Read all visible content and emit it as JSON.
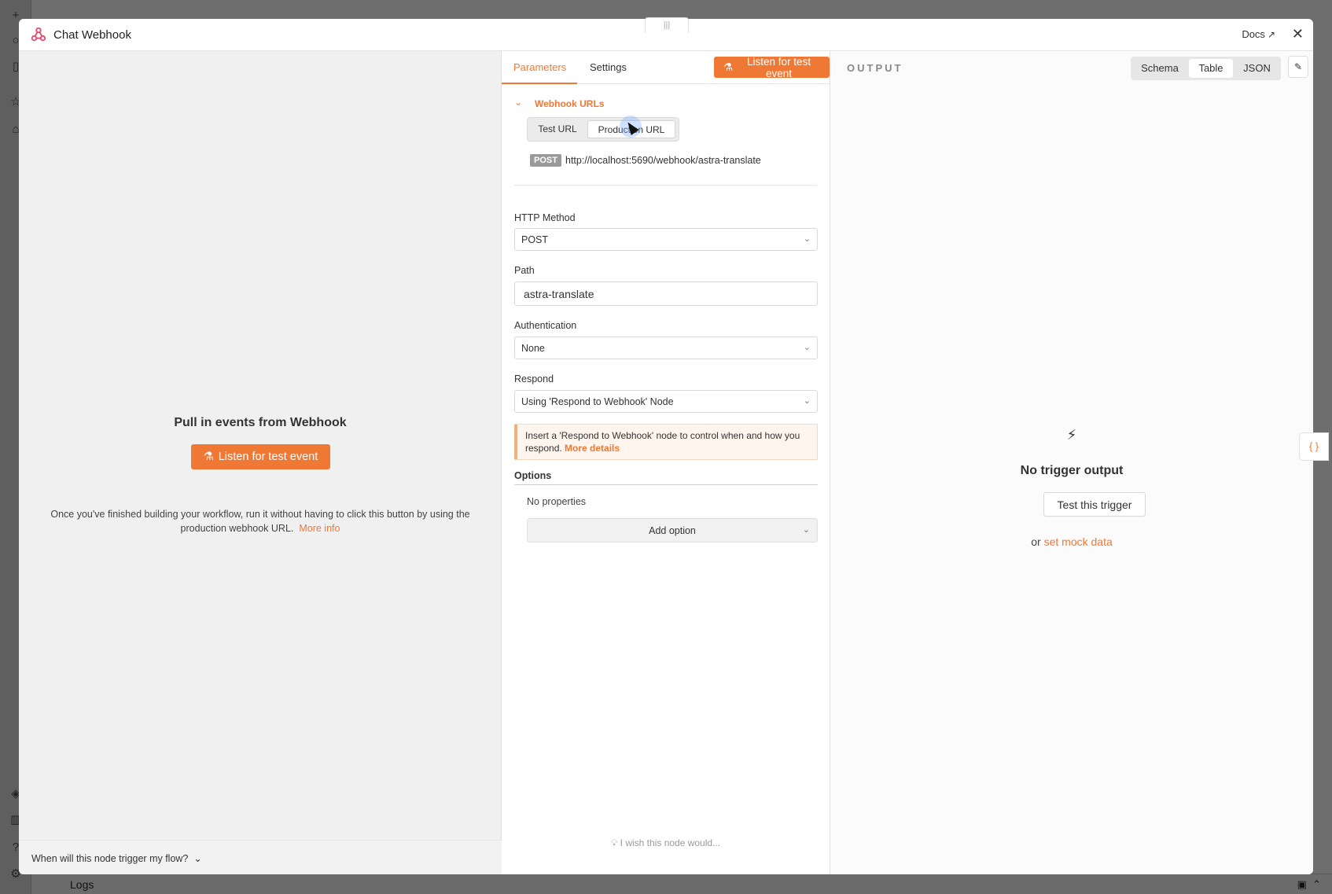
{
  "modal": {
    "title": "Chat Webhook",
    "docs_label": "Docs",
    "close_glyph": "✕"
  },
  "left": {
    "heading": "Pull in events from Webhook",
    "listen_label": "Listen for test event",
    "description": "Once you've finished building your workflow, run it without having to click this button by using the production webhook URL.",
    "more_info": "More info",
    "trigger_question": "When will this node trigger my flow?"
  },
  "tabs": {
    "parameters": "Parameters",
    "settings": "Settings",
    "listen_label": "Listen for test event"
  },
  "webhook_urls": {
    "title": "Webhook URLs",
    "options": [
      "Test URL",
      "Production URL"
    ],
    "selected": "Production URL",
    "method_badge": "POST",
    "url": "http://localhost:5690/webhook/astra-translate"
  },
  "fields": {
    "http_method_label": "HTTP Method",
    "http_method_value": "POST",
    "path_label": "Path",
    "path_value": "astra-translate",
    "auth_label": "Authentication",
    "auth_value": "None",
    "respond_label": "Respond",
    "respond_value": "Using 'Respond to Webhook' Node"
  },
  "notice": {
    "text": "Insert a 'Respond to Webhook' node to control when and how you respond.",
    "link": "More details"
  },
  "options": {
    "label": "Options",
    "empty": "No properties",
    "add_label": "Add option"
  },
  "wish": "I wish this node would...",
  "output": {
    "label": "OUTPUT",
    "views": [
      "Schema",
      "Table",
      "JSON"
    ],
    "selected_view": "Table",
    "empty_title": "No trigger output",
    "test_button": "Test this trigger",
    "or": "or",
    "mock_link": "set mock data"
  },
  "background": {
    "logs_label": "Logs"
  },
  "colors": {
    "accent": "#f07835",
    "panel_bg": "#f0f0f0",
    "overlay": "#6e6e6e"
  }
}
